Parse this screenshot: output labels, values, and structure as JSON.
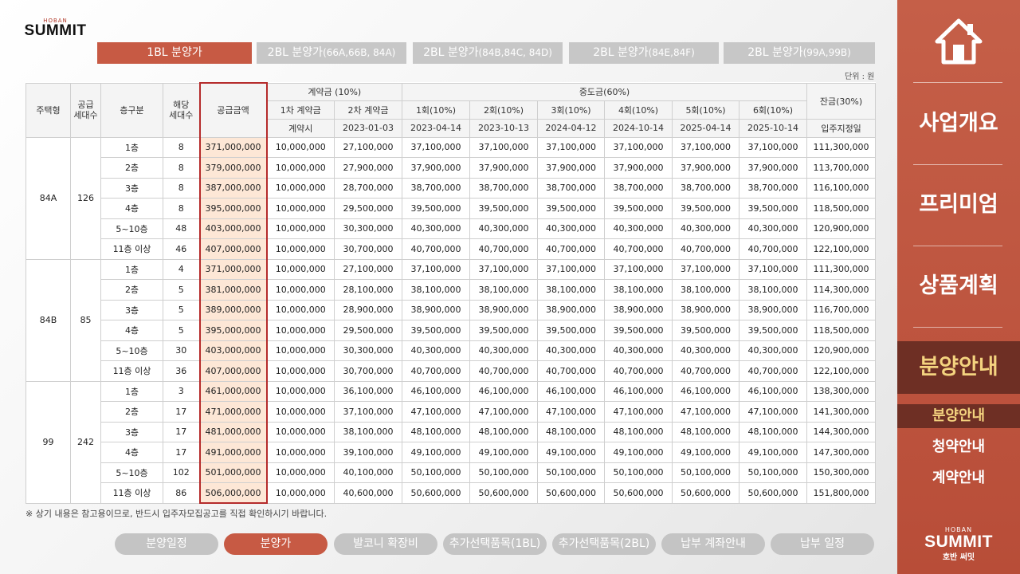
{
  "logo": {
    "small": "HOBAN",
    "main": "SUMMIT"
  },
  "tabs": [
    {
      "label": "1BL 분양가",
      "sub": ""
    },
    {
      "label": "2BL 분양가",
      "sub": "(66A,66B, 84A)"
    },
    {
      "label": "2BL 분양가",
      "sub": "(84B,84C, 84D)"
    },
    {
      "label": "2BL 분양가",
      "sub": "(84E,84F)"
    },
    {
      "label": "2BL 분양가",
      "sub": "(99A,99B)"
    }
  ],
  "unit": "단위 : 원",
  "table": {
    "headers": {
      "type": "주택형",
      "supply_units": "공급\n세대수",
      "floor": "층구분",
      "units": "해당\n세대수",
      "supply_price": "공급금액",
      "deposit": "계약금 (10%)",
      "interim": "중도금(60%)",
      "balance": "잔금(30%)",
      "dep1": "1차 계약금",
      "dep2": "2차 계약금",
      "i1": "1회(10%)",
      "i2": "2회(10%)",
      "i3": "3회(10%)",
      "i4": "4회(10%)",
      "i5": "5회(10%)",
      "i6": "6회(10%)",
      "dep1_date": "계약시",
      "dep2_date": "2023-01-03",
      "i1_date": "2023-04-14",
      "i2_date": "2023-10-13",
      "i3_date": "2024-04-12",
      "i4_date": "2024-10-14",
      "i5_date": "2025-04-14",
      "i6_date": "2025-10-14",
      "balance_date": "입주지정일"
    },
    "groups": [
      {
        "type": "84A",
        "supply_units": "126",
        "rows": [
          [
            "1층",
            "8",
            "371,000,000",
            "10,000,000",
            "27,100,000",
            "37,100,000",
            "37,100,000",
            "37,100,000",
            "37,100,000",
            "37,100,000",
            "37,100,000",
            "111,300,000"
          ],
          [
            "2층",
            "8",
            "379,000,000",
            "10,000,000",
            "27,900,000",
            "37,900,000",
            "37,900,000",
            "37,900,000",
            "37,900,000",
            "37,900,000",
            "37,900,000",
            "113,700,000"
          ],
          [
            "3층",
            "8",
            "387,000,000",
            "10,000,000",
            "28,700,000",
            "38,700,000",
            "38,700,000",
            "38,700,000",
            "38,700,000",
            "38,700,000",
            "38,700,000",
            "116,100,000"
          ],
          [
            "4층",
            "8",
            "395,000,000",
            "10,000,000",
            "29,500,000",
            "39,500,000",
            "39,500,000",
            "39,500,000",
            "39,500,000",
            "39,500,000",
            "39,500,000",
            "118,500,000"
          ],
          [
            "5~10층",
            "48",
            "403,000,000",
            "10,000,000",
            "30,300,000",
            "40,300,000",
            "40,300,000",
            "40,300,000",
            "40,300,000",
            "40,300,000",
            "40,300,000",
            "120,900,000"
          ],
          [
            "11층 이상",
            "46",
            "407,000,000",
            "10,000,000",
            "30,700,000",
            "40,700,000",
            "40,700,000",
            "40,700,000",
            "40,700,000",
            "40,700,000",
            "40,700,000",
            "122,100,000"
          ]
        ]
      },
      {
        "type": "84B",
        "supply_units": "85",
        "rows": [
          [
            "1층",
            "4",
            "371,000,000",
            "10,000,000",
            "27,100,000",
            "37,100,000",
            "37,100,000",
            "37,100,000",
            "37,100,000",
            "37,100,000",
            "37,100,000",
            "111,300,000"
          ],
          [
            "2층",
            "5",
            "381,000,000",
            "10,000,000",
            "28,100,000",
            "38,100,000",
            "38,100,000",
            "38,100,000",
            "38,100,000",
            "38,100,000",
            "38,100,000",
            "114,300,000"
          ],
          [
            "3층",
            "5",
            "389,000,000",
            "10,000,000",
            "28,900,000",
            "38,900,000",
            "38,900,000",
            "38,900,000",
            "38,900,000",
            "38,900,000",
            "38,900,000",
            "116,700,000"
          ],
          [
            "4층",
            "5",
            "395,000,000",
            "10,000,000",
            "29,500,000",
            "39,500,000",
            "39,500,000",
            "39,500,000",
            "39,500,000",
            "39,500,000",
            "39,500,000",
            "118,500,000"
          ],
          [
            "5~10층",
            "30",
            "403,000,000",
            "10,000,000",
            "30,300,000",
            "40,300,000",
            "40,300,000",
            "40,300,000",
            "40,300,000",
            "40,300,000",
            "40,300,000",
            "120,900,000"
          ],
          [
            "11층 이상",
            "36",
            "407,000,000",
            "10,000,000",
            "30,700,000",
            "40,700,000",
            "40,700,000",
            "40,700,000",
            "40,700,000",
            "40,700,000",
            "40,700,000",
            "122,100,000"
          ]
        ]
      },
      {
        "type": "99",
        "supply_units": "242",
        "rows": [
          [
            "1층",
            "3",
            "461,000,000",
            "10,000,000",
            "36,100,000",
            "46,100,000",
            "46,100,000",
            "46,100,000",
            "46,100,000",
            "46,100,000",
            "46,100,000",
            "138,300,000"
          ],
          [
            "2층",
            "17",
            "471,000,000",
            "10,000,000",
            "37,100,000",
            "47,100,000",
            "47,100,000",
            "47,100,000",
            "47,100,000",
            "47,100,000",
            "47,100,000",
            "141,300,000"
          ],
          [
            "3층",
            "17",
            "481,000,000",
            "10,000,000",
            "38,100,000",
            "48,100,000",
            "48,100,000",
            "48,100,000",
            "48,100,000",
            "48,100,000",
            "48,100,000",
            "144,300,000"
          ],
          [
            "4층",
            "17",
            "491,000,000",
            "10,000,000",
            "39,100,000",
            "49,100,000",
            "49,100,000",
            "49,100,000",
            "49,100,000",
            "49,100,000",
            "49,100,000",
            "147,300,000"
          ],
          [
            "5~10층",
            "102",
            "501,000,000",
            "10,000,000",
            "40,100,000",
            "50,100,000",
            "50,100,000",
            "50,100,000",
            "50,100,000",
            "50,100,000",
            "50,100,000",
            "150,300,000"
          ],
          [
            "11층 이상",
            "86",
            "506,000,000",
            "10,000,000",
            "40,600,000",
            "50,600,000",
            "50,600,000",
            "50,600,000",
            "50,600,000",
            "50,600,000",
            "50,600,000",
            "151,800,000"
          ]
        ]
      }
    ]
  },
  "note": "※ 상기 내용은 참고용이므로, 반드시 입주자모집공고를 직접 확인하시기 바랍니다.",
  "bottom_buttons": [
    "분양일정",
    "분양가",
    "발코니 확장비",
    "추가선택품목(1BL)",
    "추가선택품목(2BL)",
    "납부 계좌안내",
    "납부 일정"
  ],
  "sidebar": {
    "home_icon": "home-icon",
    "menu": [
      "사업개요",
      "프리미엄",
      "상품계획",
      "분양안내"
    ],
    "submenu": [
      "분양안내",
      "청약안내",
      "계약안내"
    ],
    "logo": {
      "small": "HOBAN",
      "main": "SUMMIT",
      "kr": "호반 써밋"
    }
  },
  "colors": {
    "accent": "#c75a44",
    "panel": "#bf5540",
    "active_dark": "#6e2f24",
    "active_text": "#f4d37f",
    "highlight_col": "#fde7d6",
    "highlight_border": "#b52b2b"
  }
}
